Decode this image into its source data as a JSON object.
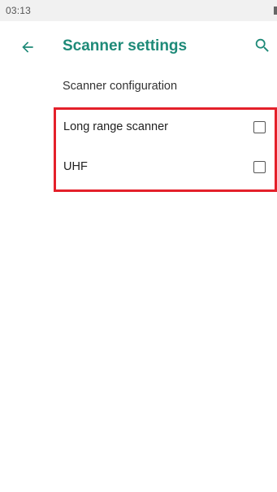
{
  "status_bar": {
    "time": "03:13",
    "battery_icon": "battery-icon"
  },
  "app_bar": {
    "title": "Scanner settings",
    "back_icon": "arrow-left-icon",
    "search_icon": "search-icon",
    "accent_color": "#1e8a78"
  },
  "section": {
    "header": "Scanner configuration"
  },
  "preferences": [
    {
      "label": "Long range scanner",
      "checked": false
    },
    {
      "label": "UHF",
      "checked": false
    }
  ],
  "highlight_color": "#e4202a"
}
